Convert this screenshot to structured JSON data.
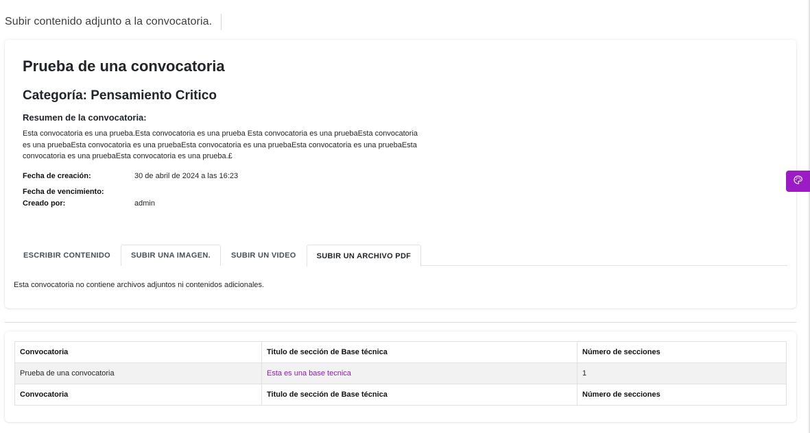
{
  "header": {
    "title": "Subir contenido adjunto a la convocatoria."
  },
  "convocatoria": {
    "title": "Prueba de una convocatoria",
    "category": "Categoría: Pensamiento Critico",
    "summary_label": "Resumen de la convocatoria:",
    "summary_lines": [
      "Esta convocatoria es una prueba.Esta convocatoria es una prueba Esta convocatoria es una pruebaEsta convocatoria",
      "es una pruebaEsta convocatoria es una pruebaEsta convocatoria es una pruebaEsta convocatoria es una pruebaEsta",
      "convocatoria es una pruebaEsta convocatoria es una prueba.£"
    ],
    "fecha_creacion_label": "Fecha de creación:",
    "fecha_creacion_value": "30 de abril de 2024 a las 16:23",
    "fecha_vencimiento_label": "Fecha de vencimiento:",
    "fecha_vencimiento_value": "",
    "creado_por_label": "Creado por:",
    "creado_por_value": "admin"
  },
  "tabs": [
    {
      "label": "ESCRIBIR CONTENIDO"
    },
    {
      "label": "SUBIR UNA IMAGEN."
    },
    {
      "label": "SUBIR UN VIDEO"
    },
    {
      "label": "SUBIR UN ARCHIVO PDF"
    }
  ],
  "active_tab": "SUBIR UN ARCHIVO PDF",
  "tab_content": {
    "message": "Esta convocatoria no contiene archivos adjuntos ni contenidos adicionales."
  },
  "table": {
    "headers": [
      "Convocatoria",
      "Titulo de sección de Base técnica",
      "Número de secciones"
    ],
    "rows": [
      [
        "Prueba de una convocatoria",
        "Esta es una base tecnica",
        "1"
      ]
    ],
    "footers": [
      "Convocatoria",
      "Titulo de sección de Base técnica",
      "Número de secciones"
    ]
  },
  "floating_button": {
    "icon": "palette-icon"
  },
  "colors": {
    "accent": "#9b1bc4",
    "link": "#8e1ab0",
    "stripe": "#f2f2f2"
  }
}
